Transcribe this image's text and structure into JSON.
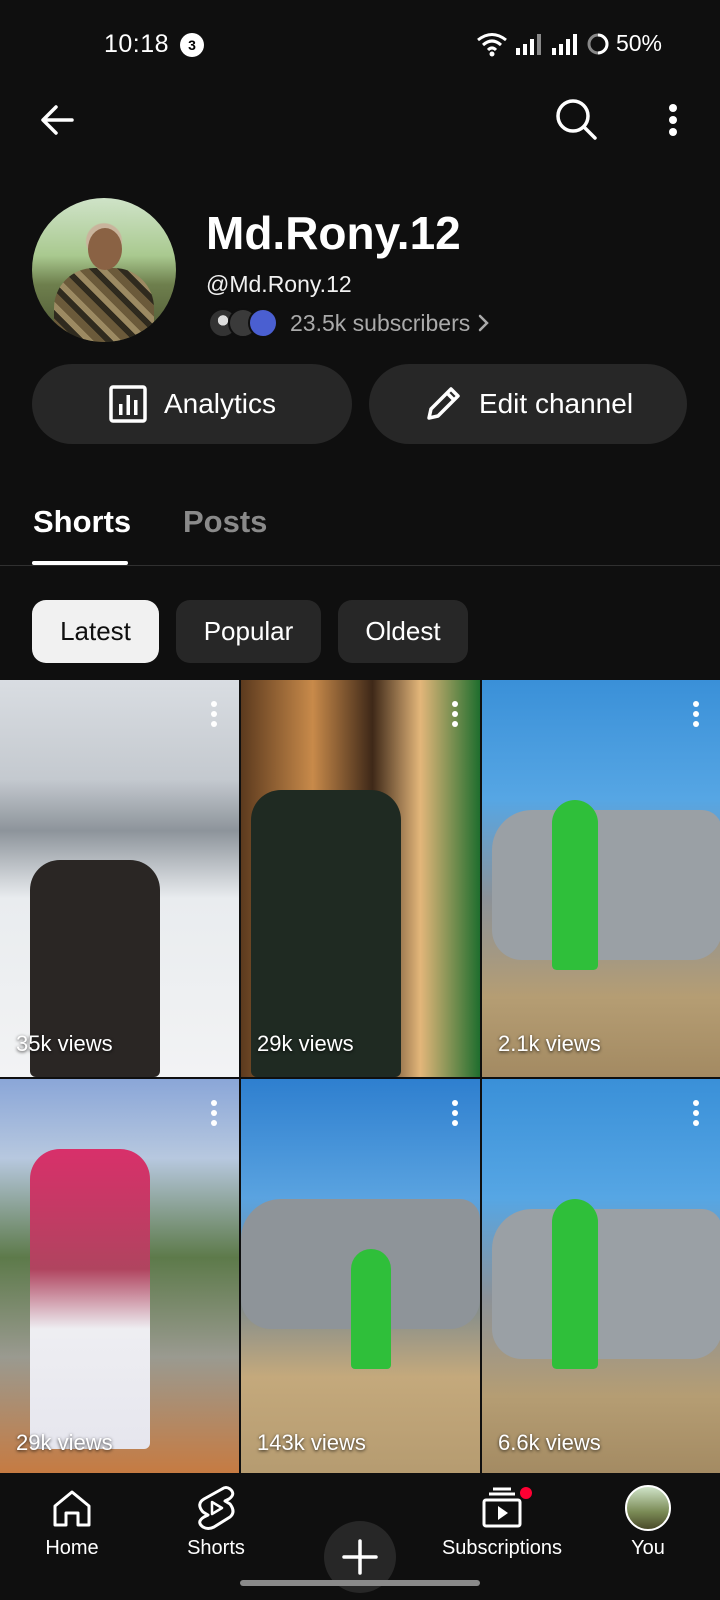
{
  "status_bar": {
    "time": "10:18",
    "notification_count": "3",
    "battery": "50%"
  },
  "channel": {
    "name": "Md.Rony.12",
    "handle": "@Md.Rony.12",
    "subscribers": "23.5k subscribers"
  },
  "actions": {
    "analytics": "Analytics",
    "edit": "Edit channel"
  },
  "tabs": [
    {
      "label": "Shorts"
    },
    {
      "label": "Posts"
    }
  ],
  "filters": [
    {
      "label": "Latest"
    },
    {
      "label": "Popular"
    },
    {
      "label": "Oldest"
    }
  ],
  "shorts": [
    {
      "views": "35k views"
    },
    {
      "views": "29k views"
    },
    {
      "views": "2.1k views"
    },
    {
      "views": "29k views"
    },
    {
      "views": "143k views"
    },
    {
      "views": "6.6k views"
    }
  ],
  "bottom_nav": [
    {
      "label": "Home"
    },
    {
      "label": "Shorts"
    },
    {
      "label": "Subscriptions"
    },
    {
      "label": "You"
    }
  ],
  "colors": {
    "background": "#0f0f0f",
    "chip": "#272727",
    "accent_red": "#ff0033",
    "secondary_text": "#aaaaaa"
  },
  "icons": [
    "back-arrow-icon",
    "search-icon",
    "more-vert-icon",
    "analytics-icon",
    "pencil-icon",
    "home-icon",
    "shorts-icon",
    "create-icon",
    "subscriptions-icon"
  ]
}
